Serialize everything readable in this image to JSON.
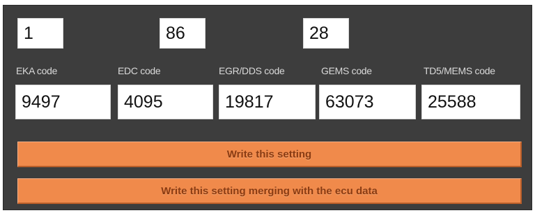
{
  "top_values": [
    "1",
    "86",
    "28"
  ],
  "codes": [
    {
      "label": "EKA code",
      "value": "9497"
    },
    {
      "label": "EDC code",
      "value": "4095"
    },
    {
      "label": "EGR/DDS code",
      "value": "19817"
    },
    {
      "label": "GEMS code",
      "value": "63073"
    },
    {
      "label": "TD5/MEMS code",
      "value": "25588"
    }
  ],
  "buttons": {
    "write": "Write this setting",
    "write_merge": "Write this setting merging with the ecu data"
  },
  "colors": {
    "panel_bg": "#3d3d3d",
    "button_bg": "#f08a4b",
    "button_text": "#8a3b12",
    "label_text": "#d9d9d9"
  }
}
